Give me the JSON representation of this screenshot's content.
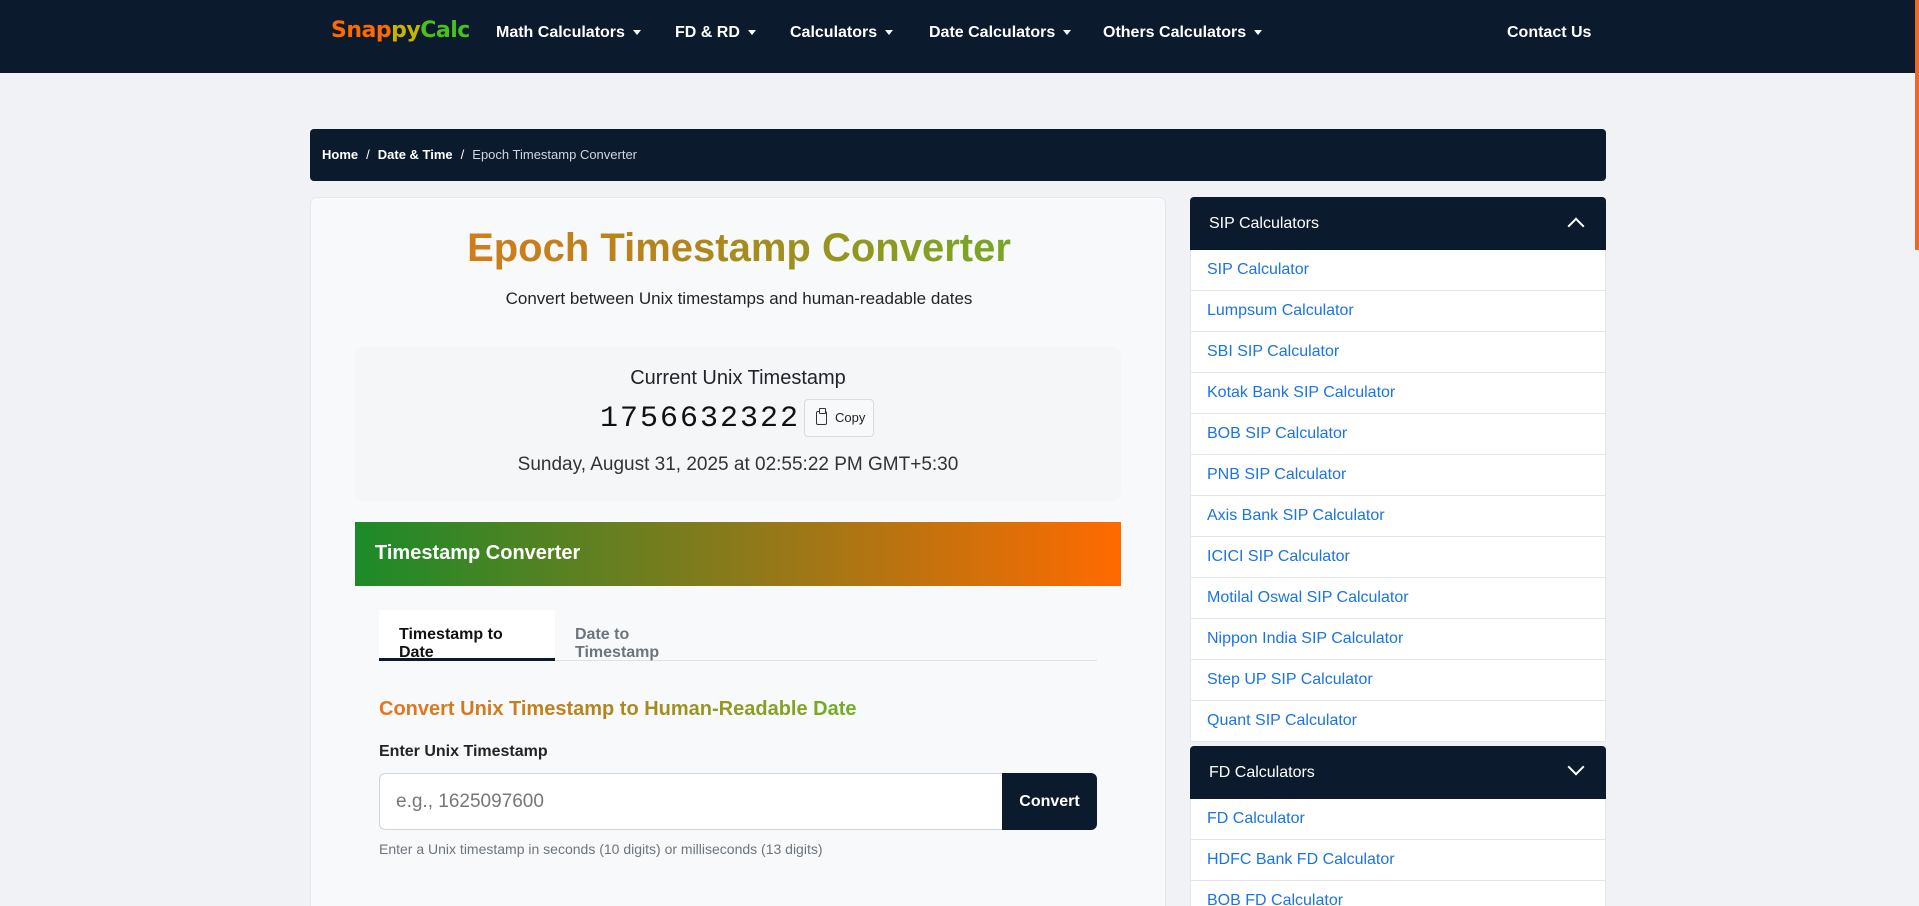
{
  "navbar": {
    "brand": {
      "part1": "Snap",
      "part2": "py",
      "part3": "Calc"
    },
    "items": [
      {
        "label": "Math Calculators"
      },
      {
        "label": "FD & RD"
      },
      {
        "label": "Calculators"
      },
      {
        "label": "Date Calculators"
      },
      {
        "label": "Others Calculators"
      }
    ],
    "contact": "Contact Us"
  },
  "breadcrumb": {
    "home": "Home",
    "section": "Date & Time",
    "current": "Epoch Timestamp Converter",
    "separator": "/"
  },
  "main": {
    "title": "Epoch Timestamp Converter",
    "subtitle": "Convert between Unix timestamps and human-readable dates",
    "current": {
      "label": "Current Unix Timestamp",
      "value": "1756632322",
      "copy_label": "Copy",
      "date": "Sunday, August 31, 2025 at 02:55:22 PM GMT+5:30"
    },
    "converter": {
      "header": "Timestamp Converter",
      "tabs": [
        {
          "label": "Timestamp to Date",
          "active": true
        },
        {
          "label": "Date to Timestamp",
          "active": false
        }
      ],
      "section_title": "Convert Unix Timestamp to Human-Readable Date",
      "input_label": "Enter Unix Timestamp",
      "input_placeholder": "e.g., 1625097600",
      "input_value": "",
      "convert_label": "Convert",
      "help": "Enter a Unix timestamp in seconds (10 digits) or milliseconds (13 digits)"
    }
  },
  "sidebar": {
    "sip": {
      "title": "SIP Calculators",
      "expanded": true,
      "items": [
        "SIP Calculator",
        "Lumpsum Calculator",
        "SBI SIP Calculator",
        "Kotak Bank SIP Calculator",
        "BOB SIP Calculator",
        "PNB SIP Calculator",
        "Axis Bank SIP Calculator",
        "ICICI SIP Calculator",
        "Motilal Oswal SIP Calculator",
        "Nippon India SIP Calculator",
        "Step UP SIP Calculator",
        "Quant SIP Calculator"
      ]
    },
    "fd": {
      "title": "FD Calculators",
      "expanded": false,
      "items": [
        "FD Calculator",
        "HDFC Bank FD Calculator",
        "BOB FD Calculator"
      ]
    }
  },
  "colors": {
    "navy": "#0b1a2c",
    "brand_orange": "#ff6a00",
    "brand_yellow": "#c8b400",
    "brand_green": "#45c21b",
    "link_blue": "#1b74e4"
  }
}
